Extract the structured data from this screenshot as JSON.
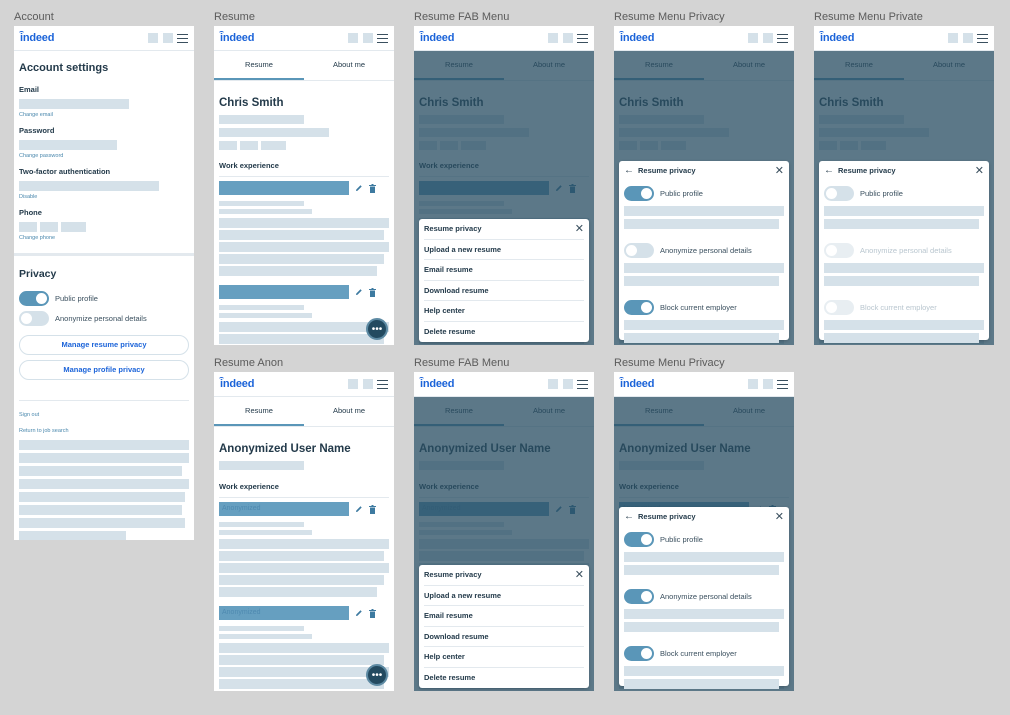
{
  "brand": {
    "logo": "indeed",
    "accent": "#1c64d9",
    "primary": "#5a96b8",
    "job_bar": "#669fc0"
  },
  "header": {
    "icons": [
      "square-icon",
      "square-icon",
      "hamburger-menu-icon"
    ]
  },
  "tabs": [
    "Resume",
    "About me"
  ],
  "account": {
    "artboard_label": "Account",
    "title": "Account settings",
    "fields": [
      {
        "label": "Email",
        "link": "Change email"
      },
      {
        "label": "Password",
        "link": "Change password"
      },
      {
        "label": "Two-factor authentication",
        "link": "Disable"
      },
      {
        "label": "Phone",
        "link": "Change phone"
      }
    ],
    "privacy_title": "Privacy",
    "toggles": [
      {
        "label": "Public profile",
        "on": true
      },
      {
        "label": "Anonymize personal details",
        "on": false
      }
    ],
    "buttons": [
      "Manage resume privacy",
      "Manage profile privacy"
    ],
    "footer_links": [
      "Sign out",
      "Return to job search"
    ]
  },
  "resume": {
    "name": "Chris Smith",
    "anon_name": "Anonymized User Name",
    "work_experience": "Work experience",
    "anon_job_label": "Anonymized",
    "fab_label": "•••"
  },
  "fab_menu": {
    "items": [
      "Resume privacy",
      "Upload a new resume",
      "Email resume",
      "Download resume",
      "Help center",
      "Delete resume"
    ],
    "close": "✕"
  },
  "privacy_sheet": {
    "title": "Resume privacy",
    "back": "←",
    "close": "✕",
    "toggle_labels": [
      "Public profile",
      "Anonymize personal details",
      "Block current employer"
    ]
  },
  "artboards": [
    {
      "label": "Account",
      "type": "account"
    },
    {
      "label": "Resume",
      "type": "resume"
    },
    {
      "label": "Resume FAB Menu",
      "type": "resume",
      "overlay": "menu"
    },
    {
      "label": "Resume Menu Privacy",
      "type": "resume",
      "overlay": "privacy",
      "toggles": [
        true,
        false,
        true
      ]
    },
    {
      "label": "Resume Menu Private",
      "type": "resume",
      "overlay": "privacy",
      "toggles": [
        false,
        false,
        false
      ],
      "disabled": [
        false,
        true,
        true
      ]
    },
    {
      "label": "Resume Anon",
      "type": "anon"
    },
    {
      "label": "Resume FAB Menu",
      "type": "anon",
      "overlay": "menu"
    },
    {
      "label": "Resume Menu Privacy",
      "type": "anon",
      "overlay": "privacy",
      "toggles": [
        true,
        true,
        true
      ]
    }
  ]
}
